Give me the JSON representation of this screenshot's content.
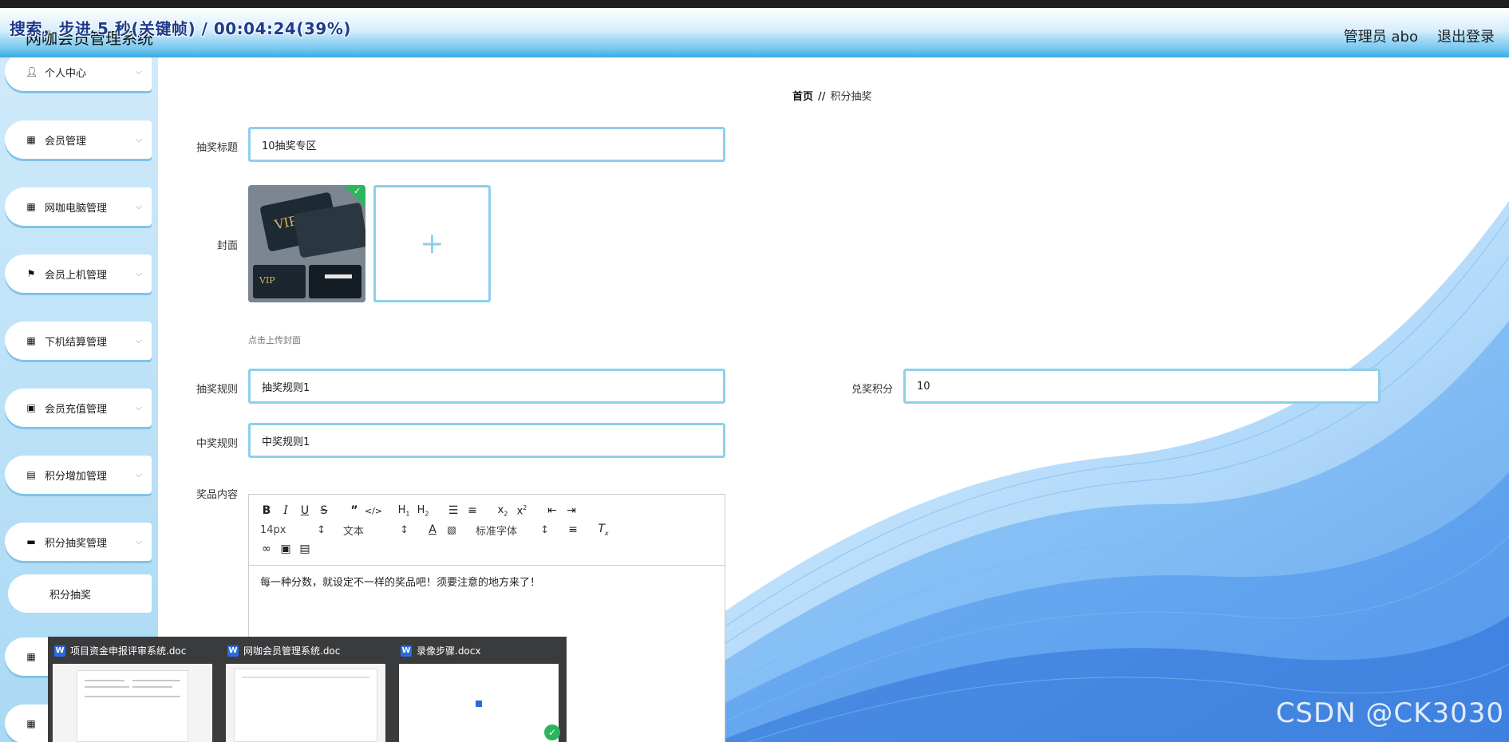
{
  "header": {
    "title": "网咖会员管理系统",
    "recording_overlay": "搜索，步进 5 秒(关键帧) / 00:04:24(39%)",
    "admin_label": "管理员 abo",
    "logout_label": "退出登录"
  },
  "sidebar": {
    "items": [
      {
        "label": "个人中心",
        "icon": "user-icon"
      },
      {
        "label": "会员管理",
        "icon": "grid-icon"
      },
      {
        "label": "网咖电脑管理",
        "icon": "grid-icon"
      },
      {
        "label": "会员上机管理",
        "icon": "flag-icon"
      },
      {
        "label": "下机结算管理",
        "icon": "grid-icon"
      },
      {
        "label": "会员充值管理",
        "icon": "wallet-icon"
      },
      {
        "label": "积分增加管理",
        "icon": "chat-icon"
      },
      {
        "label": "积分抽奖管理",
        "icon": "monitor-icon"
      }
    ],
    "active_sub_item": "积分抽奖"
  },
  "breadcrumb": {
    "home": "首页",
    "separator": "//",
    "current": "积分抽奖"
  },
  "form": {
    "title_label": "抽奖标题",
    "title_value": "10抽奖专区",
    "cover_label": "封面",
    "upload_tip": "点击上传封面",
    "rule_label": "抽奖规则",
    "rule_value": "抽奖规则1",
    "points_label": "兑奖积分",
    "points_value": "10",
    "win_rule_label": "中奖规则",
    "win_rule_value": "中奖规则1",
    "prize_label": "奖品内容",
    "editor": {
      "font_size": "14px",
      "paragraph": "文本",
      "font_family": "标准字体",
      "content": "每一种分数，就设定不一样的奖品吧！须要注意的地方来了！"
    }
  },
  "taskbar": {
    "items": [
      {
        "title": "项目资金申报评审系统.doc"
      },
      {
        "title": "网咖会员管理系统.doc"
      },
      {
        "title": "录像步骤.docx"
      }
    ]
  },
  "watermark": "CSDN @CK3030"
}
